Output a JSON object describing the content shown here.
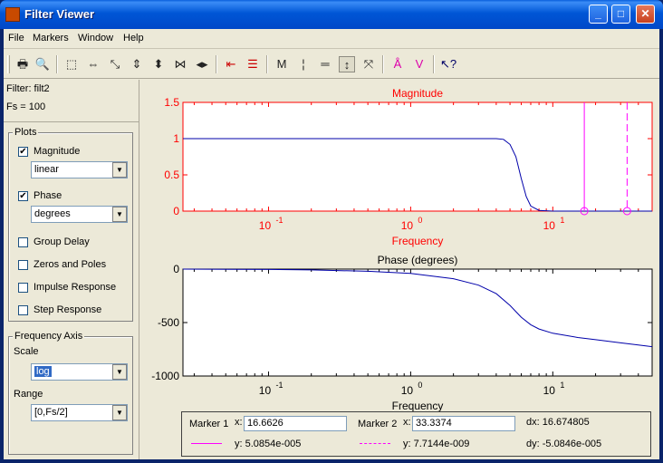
{
  "window": {
    "title": "Filter Viewer"
  },
  "menu": [
    "File",
    "Markers",
    "Window",
    "Help"
  ],
  "toolbar": {
    "icons": [
      "print-icon",
      "print-preview-icon",
      "zoom-box-icon",
      "zoom-x-icon",
      "zoom-xy-icon",
      "zoom-y-icon",
      "zoom-y-in-icon",
      "zoom-x-out-icon",
      "zoom-x-in-icon",
      "marker-left-icon",
      "marker-lines-icon",
      "measure-icon",
      "vertical-lines-icon",
      "horizontal-lines-icon",
      "marker-add-icon",
      "marker-delete-icon",
      "peak-icon",
      "valley-icon",
      "context-help-icon"
    ]
  },
  "filter": {
    "name_label": "Filter: filt2",
    "fs_label": "Fs = 100"
  },
  "plots_group": {
    "title": "Plots",
    "magnitude": {
      "label": "Magnitude",
      "checked": true,
      "mode": "linear"
    },
    "phase": {
      "label": "Phase",
      "checked": true,
      "mode": "degrees"
    },
    "group_delay": {
      "label": "Group Delay",
      "checked": false
    },
    "zeros_poles": {
      "label": "Zeros and Poles",
      "checked": false
    },
    "impulse": {
      "label": "Impulse Response",
      "checked": false
    },
    "step": {
      "label": "Step Response",
      "checked": false
    }
  },
  "freq_axis": {
    "title": "Frequency Axis",
    "scale_label": "Scale",
    "scale_value": "log",
    "range_label": "Range",
    "range_value": "[0,Fs/2]"
  },
  "colors": {
    "magnitude_axis": "#ff0000",
    "trace": "#0000aa",
    "marker": "#ff00ff"
  },
  "chart_data": [
    {
      "type": "line",
      "title": "Magnitude",
      "xlabel": "Frequency",
      "ylabel": "",
      "xscale": "log",
      "xlim": [
        0.025,
        50
      ],
      "ylim": [
        0,
        1.5
      ],
      "yticks": [
        "0",
        "0.5",
        "1",
        "1.5"
      ],
      "xticks": [
        {
          "base": "10",
          "exp": "-1",
          "v": 0.1
        },
        {
          "base": "10",
          "exp": "0",
          "v": 1
        },
        {
          "base": "10",
          "exp": "1",
          "v": 10
        }
      ],
      "x": [
        0.025,
        0.1,
        0.5,
        1,
        2,
        3,
        4,
        4.5,
        5,
        5.5,
        6,
        6.5,
        7,
        8,
        10,
        20,
        50
      ],
      "y": [
        1.0,
        1.0,
        1.0,
        1.0,
        1.0,
        1.0,
        1.0,
        0.99,
        0.92,
        0.75,
        0.45,
        0.2,
        0.07,
        0.01,
        0.0,
        0.0,
        0.0
      ],
      "markers": [
        {
          "x": 16.6626,
          "style": "solid"
        },
        {
          "x": 33.3374,
          "style": "dashed"
        }
      ],
      "grid": false
    },
    {
      "type": "line",
      "title": "Phase (degrees)",
      "xlabel": "Frequency",
      "ylabel": "",
      "xscale": "log",
      "xlim": [
        0.025,
        50
      ],
      "ylim": [
        -1000,
        0
      ],
      "yticks": [
        "-1000",
        "-500",
        "0"
      ],
      "xticks": [
        {
          "base": "10",
          "exp": "-1",
          "v": 0.1
        },
        {
          "base": "10",
          "exp": "0",
          "v": 1
        },
        {
          "base": "10",
          "exp": "1",
          "v": 10
        }
      ],
      "x": [
        0.025,
        0.1,
        0.2,
        0.5,
        1,
        2,
        3,
        4,
        5,
        6,
        7,
        8,
        10,
        15,
        20,
        30,
        40,
        50
      ],
      "y": [
        0,
        -3,
        -8,
        -20,
        -40,
        -90,
        -150,
        -230,
        -340,
        -450,
        -520,
        -560,
        -600,
        -640,
        -660,
        -690,
        -710,
        -725
      ],
      "grid": false
    }
  ],
  "markers_panel": {
    "m1_label": "Marker 1",
    "m1_x_label": "x:",
    "m1_x": "16.6626",
    "m1_y": "y: 5.0854e-005",
    "m2_label": "Marker 2",
    "m2_x_label": "x:",
    "m2_x": "33.3374",
    "m2_y": "y: 7.7144e-009",
    "dx": "dx: 16.674805",
    "dy": "dy: -5.0846e-005"
  }
}
